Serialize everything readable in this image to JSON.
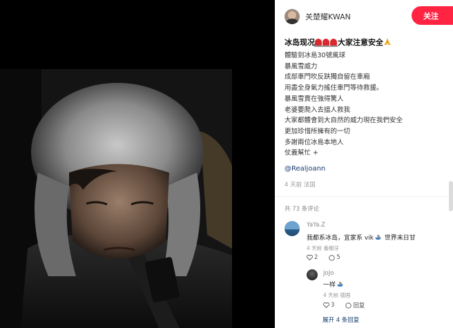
{
  "author": {
    "name": "关楚耀KWAN"
  },
  "follow_label": "关注",
  "post": {
    "title": "冰岛现况",
    "title_suffix": "大家注意安全",
    "lines": [
      "體驗到冰島30號風球",
      "暴風雪威力",
      "成部車門吹反趺獨自留在車廂",
      "用盡全身氣力搖住車門等待救援。",
      "暴風雪賣在強得驚人",
      "老婆要爬入去搵人救我",
      "大家都體會到大自然的威力現在我們安全",
      "更加珍惜所擁有的一切",
      "多謝兩位冰島本地人",
      "仗義幫忙 +"
    ],
    "mention": "@Realjoann",
    "meta": "4 天前 法国"
  },
  "comments_count": "共 73 条评论",
  "comments": [
    {
      "name": "YaYa.Z",
      "text_before": "我都系冰岛，宜家系 vik",
      "text_after": " 世界末日甘",
      "meta": "4 天前 番榭牙",
      "likes": "2",
      "replies": "5"
    },
    {
      "name": "JoJo",
      "text": "一样",
      "meta": "4 天前 德国",
      "likes": "3",
      "reply_label": "回复"
    }
  ],
  "expand_label": "展开 4 条回复",
  "icons": [
    "avatar",
    "alarm-icon",
    "pray-icon",
    "heart-icon",
    "comment-icon",
    "boat-icon"
  ],
  "colors": {
    "accent": "#ff2442",
    "link": "#13386c",
    "media_bg": "#000000"
  }
}
